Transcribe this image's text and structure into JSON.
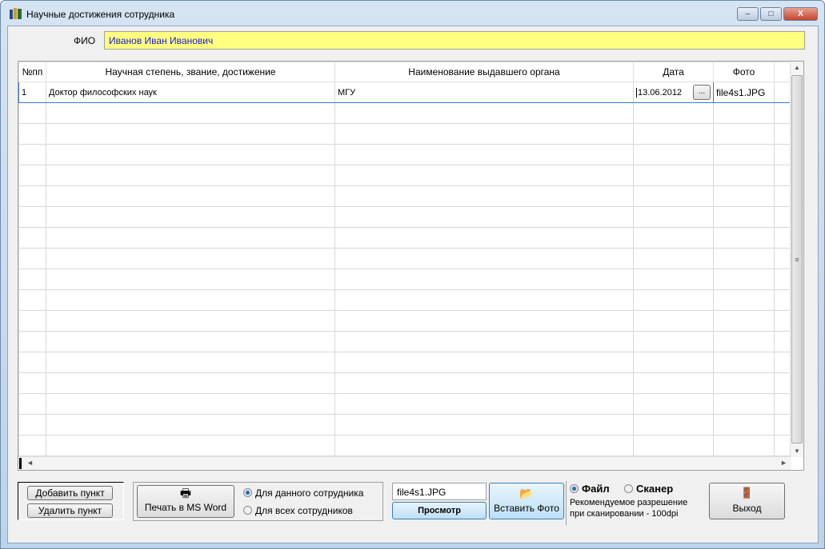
{
  "window": {
    "title": "Научные достижения сотрудника",
    "controls": [
      "–",
      "□",
      "X"
    ]
  },
  "fio": {
    "label": "ФИО",
    "value": "Иванов Иван Иванович"
  },
  "table": {
    "columns": [
      "№пп",
      "Научная степень, звание, достижение",
      "Наименование выдавшего органа",
      "Дата",
      "Фото"
    ],
    "rows": [
      {
        "num": "1",
        "degree": "Доктор философских наук",
        "issuer": "МГУ",
        "date": "13.06.2012",
        "photo": "file4s1.JPG"
      }
    ],
    "date_picker_label": "..."
  },
  "buttons": {
    "add": "Добавить пункт",
    "delete": "Удалить пункт",
    "print": "Печать в MS Word",
    "view": "Просмотр",
    "insert_photo": "Вставить Фото",
    "exit": "Выход"
  },
  "print_scope": {
    "options": [
      "Для данного сотрудника",
      "Для всех сотрудников"
    ],
    "selected": 0
  },
  "photo": {
    "filename": "file4s1.JPG"
  },
  "source": {
    "options": [
      "Файл",
      "Сканер"
    ],
    "selected": 0,
    "hint1": "Рекомендуемое разрешение",
    "hint2": "при сканировании - 100dpi"
  }
}
